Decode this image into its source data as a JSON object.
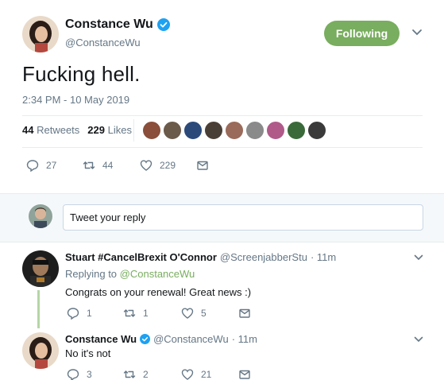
{
  "main_tweet": {
    "display_name": "Constance Wu",
    "handle": "@ConstanceWu",
    "follow_label": "Following",
    "text": "Fucking hell.",
    "timestamp": "2:34 PM - 10 May 2019",
    "stats": {
      "retweets_count": "44",
      "retweets_label": "Retweets",
      "likes_count": "229",
      "likes_label": "Likes"
    },
    "actions": {
      "replies": "27",
      "retweets": "44",
      "likes": "229"
    }
  },
  "reply_box": {
    "placeholder": "Tweet your reply"
  },
  "replies": [
    {
      "display_name": "Stuart #CancelBrexit O'Connor",
      "handle": "@ScreenjabberStu",
      "time": "· 11m",
      "replying_prefix": "Replying to",
      "replying_handle": "@ConstanceWu",
      "text": "Congrats on your renewal! Great news :)",
      "replies": "1",
      "retweets": "1",
      "likes": "5"
    },
    {
      "display_name": "Constance Wu",
      "handle": "@ConstanceWu",
      "time": "· 11m",
      "text": "No it's not",
      "replies": "3",
      "retweets": "2",
      "likes": "21"
    }
  ],
  "colors": {
    "accent": "#79ad5f",
    "verified": "#1da1f2",
    "muted": "#657786",
    "thread_line": "#b4d6a6"
  }
}
